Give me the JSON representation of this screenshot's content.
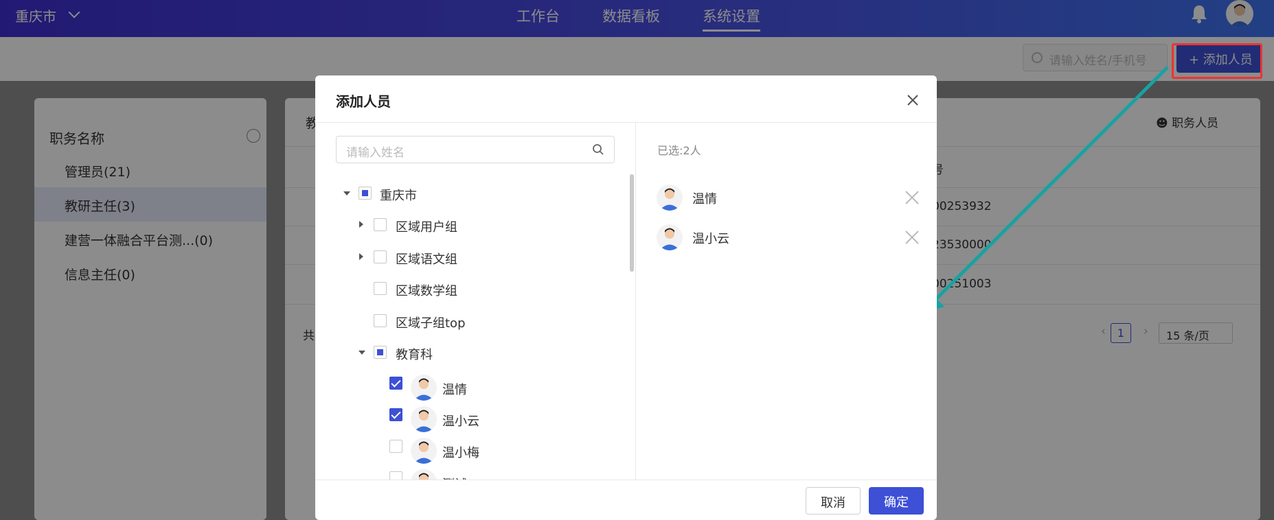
{
  "header": {
    "city": "重庆市",
    "nav": [
      "工作台",
      "数据看板",
      "系统设置"
    ],
    "active_nav": "系统设置"
  },
  "toolbar": {
    "search_placeholder": "请输入姓名/手机号",
    "add_button": "+ 添加人员"
  },
  "left_panel": {
    "title": "职务名称",
    "items": [
      {
        "label": "管理员(21)"
      },
      {
        "label": "教研主任(3)",
        "active": true
      },
      {
        "label": "建营一体融合平台测...(0)"
      },
      {
        "label": "信息主任(0)"
      }
    ]
  },
  "main_panel": {
    "tab_partial": "教",
    "members_label": "职务人员",
    "column_partial": "号",
    "cells": [
      "00253932",
      "23530000",
      "00251003"
    ],
    "total_partial": "共",
    "page": "1",
    "page_size": "15 条/页"
  },
  "modal": {
    "title": "添加人员",
    "search_placeholder": "请输入姓名",
    "tree": [
      {
        "label": "重庆市",
        "state": "partial",
        "expand": "down"
      },
      {
        "label": "区域用户组",
        "state": "unchecked",
        "expand": "right"
      },
      {
        "label": "区域语文组",
        "state": "unchecked",
        "expand": "right"
      },
      {
        "label": "区域数学组",
        "state": "unchecked"
      },
      {
        "label": "区域子组top",
        "state": "unchecked"
      },
      {
        "label": "教育科",
        "state": "partial",
        "expand": "down"
      },
      {
        "label": "温情",
        "state": "checked",
        "avatar": true
      },
      {
        "label": "温小云",
        "state": "checked",
        "avatar": true
      },
      {
        "label": "温小梅",
        "state": "unchecked",
        "avatar": true
      },
      {
        "label": "测试",
        "state": "unchecked",
        "avatar": true
      }
    ],
    "selected_count": "已选:2人",
    "selected": [
      {
        "name": "温情"
      },
      {
        "name": "温小云"
      }
    ],
    "cancel": "取消",
    "confirm": "确定"
  },
  "colors": {
    "primary": "#3d50d6",
    "header_start": "#3f2fd3",
    "header_end": "#3f74f0",
    "annotation_arrow": "#17a2a2",
    "annotation_box": "#e33333"
  }
}
